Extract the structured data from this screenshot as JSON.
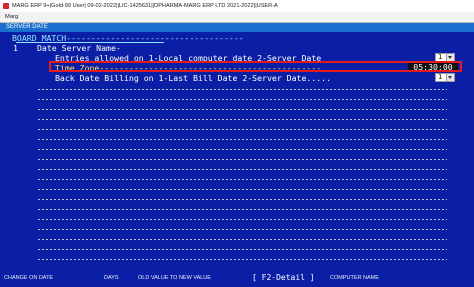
{
  "window": {
    "title": "MARG ERP 9+|Gold-99 User| 09-02-2022||LIC-1425631||DPHARMA-MARG ERP LTD 2021-2022||USER-A"
  },
  "menubar": {
    "item": "Marg"
  },
  "screen": {
    "title": "SERVER DATE"
  },
  "section": {
    "title": "BOARD MATCH------------------------------------"
  },
  "menu": {
    "number": "1",
    "option": "Date Server Name-"
  },
  "rows": {
    "entries": {
      "label": "Entries allowed on 1-Local computer date 2-Server Date",
      "value": "1"
    },
    "timezone": {
      "label": "Time Zone---------------------------------------------",
      "value": "05:30:00"
    },
    "backdate": {
      "label": "Back Date Billing on 1-Last Bill Date 2-Server Date.....",
      "value": "1"
    }
  },
  "footer": {
    "change_on_date": "CHANGE ON DATE",
    "days": "DAYS",
    "old_to_new": "OLD VALUE TO NEW VALUE",
    "f2_detail": "[ F2-Detail ]",
    "computer_name": "COMPUTER NAME"
  }
}
